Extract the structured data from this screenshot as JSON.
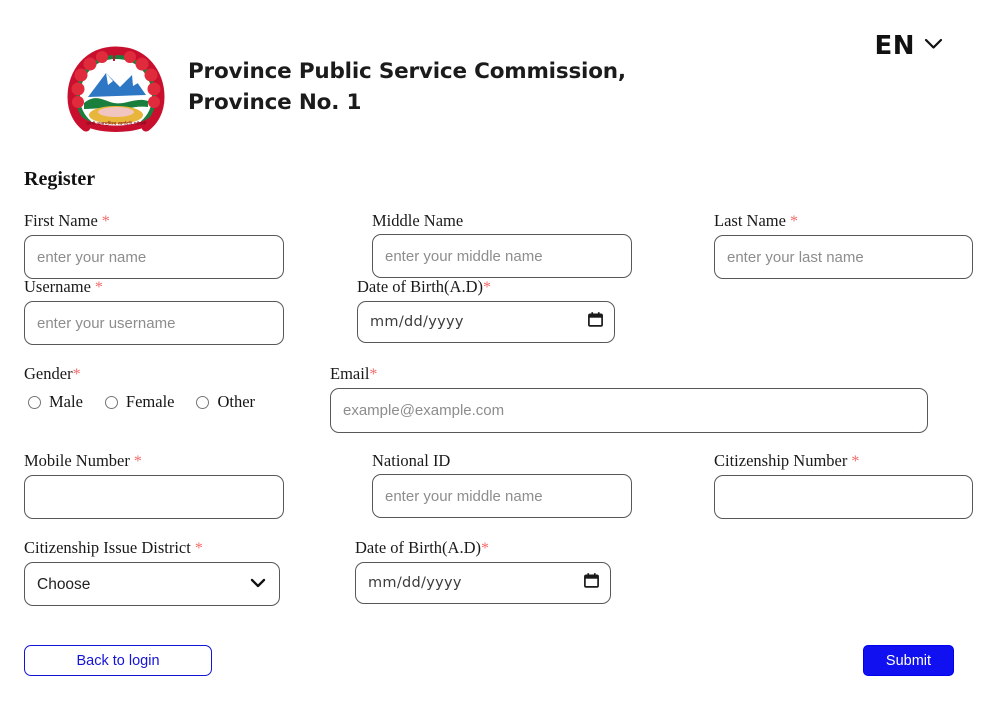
{
  "header": {
    "org_title": "Province Public Service Commission, Province No. 1",
    "logo_alt": "nepal-government-emblem",
    "language": {
      "code": "EN",
      "chevron": "chevron-down-icon"
    }
  },
  "form": {
    "title": "Register",
    "fields": {
      "first_name": {
        "label": "First Name",
        "required": true,
        "placeholder": "enter your name",
        "value": ""
      },
      "middle_name": {
        "label": "Middle Name",
        "required": false,
        "placeholder": "enter your middle name",
        "value": ""
      },
      "last_name": {
        "label": "Last Name",
        "required": true,
        "placeholder": "enter your last name",
        "value": ""
      },
      "username": {
        "label": "Username",
        "required": true,
        "placeholder": "enter your username",
        "value": ""
      },
      "dob_top": {
        "label": "Date of Birth(A.D)",
        "required": true,
        "placeholder": "mm/dd/yyyy",
        "value": ""
      },
      "gender": {
        "label": "Gender",
        "required": true,
        "options": [
          "Male",
          "Female",
          "Other"
        ],
        "selected": ""
      },
      "email": {
        "label": "Email",
        "required": true,
        "placeholder": "example@example.com",
        "value": ""
      },
      "mobile_number": {
        "label": "Mobile Number",
        "required": true,
        "placeholder": "",
        "value": ""
      },
      "national_id": {
        "label": "National ID",
        "required": false,
        "placeholder": "enter your middle name",
        "value": ""
      },
      "citizenship_number": {
        "label": "Citizenship Number",
        "required": true,
        "placeholder": "",
        "value": ""
      },
      "citizenship_issue_district": {
        "label": "Citizenship Issue District",
        "required": true,
        "selected": "Choose",
        "options": [
          "Choose"
        ]
      },
      "dob_bottom": {
        "label": "Date of Birth(A.D)",
        "required": true,
        "placeholder": "mm/dd/yyyy",
        "value": ""
      }
    },
    "required_mark": "*"
  },
  "actions": {
    "back_to_login": "Back to login",
    "submit": "Submit"
  },
  "colors": {
    "required_asterisk": "#f26b6b",
    "primary_blue": "#1010f0",
    "link_blue": "#1414d6",
    "field_border": "#585858",
    "background": "#ffffff"
  }
}
